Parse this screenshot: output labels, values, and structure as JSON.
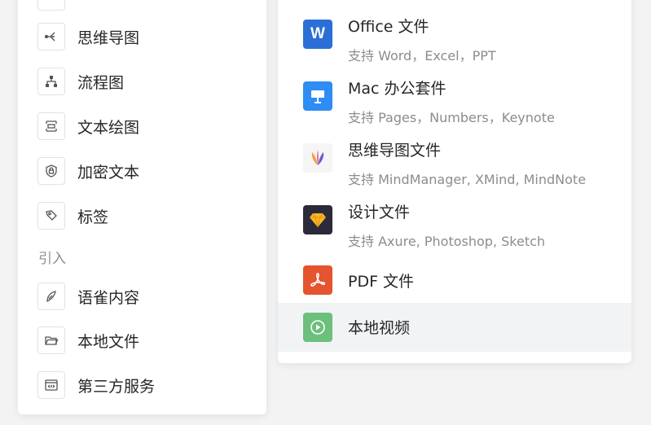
{
  "left_menu": {
    "items": [
      {
        "label": "思维导图",
        "icon": "mindmap-icon"
      },
      {
        "label": "流程图",
        "icon": "flowchart-icon"
      },
      {
        "label": "文本绘图",
        "icon": "text-drawing-icon"
      },
      {
        "label": "加密文本",
        "icon": "lock-icon"
      },
      {
        "label": "标签",
        "icon": "tag-icon"
      }
    ],
    "section_title": "引入",
    "import_items": [
      {
        "label": "语雀内容",
        "icon": "yuque-icon"
      },
      {
        "label": "本地文件",
        "icon": "folder-icon"
      },
      {
        "label": "第三方服务",
        "icon": "embed-icon"
      }
    ]
  },
  "import_menu": {
    "items": [
      {
        "title": "Office 文件",
        "subtitle": "支持 Word，Excel，PPT",
        "icon": "office-word-icon",
        "color": "#2b6fd6"
      },
      {
        "title": "Mac 办公套件",
        "subtitle": "支持 Pages，Numbers，Keynote",
        "icon": "keynote-icon",
        "color": "#2f8cf5"
      },
      {
        "title": "思维导图文件",
        "subtitle": "支持 MindManager, XMind, MindNote",
        "icon": "mindmanager-icon",
        "color": "#f5f5f5"
      },
      {
        "title": "设计文件",
        "subtitle": "支持 Axure, Photoshop, Sketch",
        "icon": "sketch-icon",
        "color": "#2a2a3a"
      },
      {
        "title": "PDF 文件",
        "subtitle": "",
        "icon": "pdf-icon",
        "color": "#e5542e"
      },
      {
        "title": "本地视频",
        "subtitle": "",
        "icon": "video-icon",
        "color": "#6cc07c"
      }
    ],
    "selected_index": 5
  }
}
